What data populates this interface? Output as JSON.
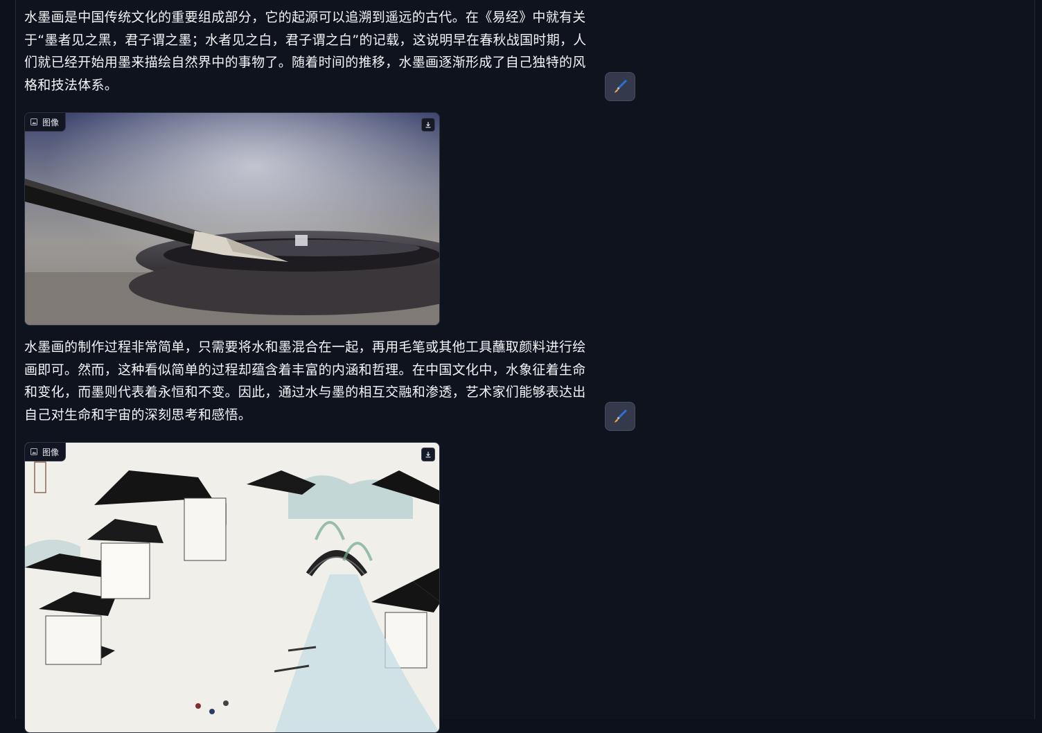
{
  "content": {
    "paragraph_1": "水墨画是中国传统文化的重要组成部分，它的起源可以追溯到遥远的古代。在《易经》中就有关于“墨者见之黑，君子谓之墨；水者见之白，君子谓之白”的记载，这说明早在春秋战国时期，人们就已经开始用墨来描绘自然界中的事物了。随着时间的推移，水墨画逐渐形成了自己独特的风格和技法体系。",
    "paragraph_2": "水墨画的制作过程非常简单，只需要将水和墨混合在一起，再用毛笔或其他工具蘸取颜料进行绘画即可。然而，这种看似简单的过程却蕴含着丰富的内涵和哲理。在中国文化中，水象征着生命和变化，而墨则代表着永恒和不变。因此，通过水与墨的相互交融和渗透，艺术家们能够表达出自己对生命和宇宙的深刻思考和感悟。"
  },
  "images": [
    {
      "tag_label": "图像",
      "subject": "brush-on-inkstone-photo",
      "download_icon": "download-icon"
    },
    {
      "tag_label": "图像",
      "subject": "ink-painting-water-town",
      "download_icon": "download-icon"
    }
  ],
  "icons": {
    "edit": "paintbrush-icon",
    "image_tag": "image-icon",
    "download": "download-icon"
  },
  "colors": {
    "background": "#0d111b",
    "text": "#f3f5f8",
    "button_bg": "#343a4c",
    "brush_handle": "#2f6fd6",
    "brush_tip": "#e8a23a"
  }
}
